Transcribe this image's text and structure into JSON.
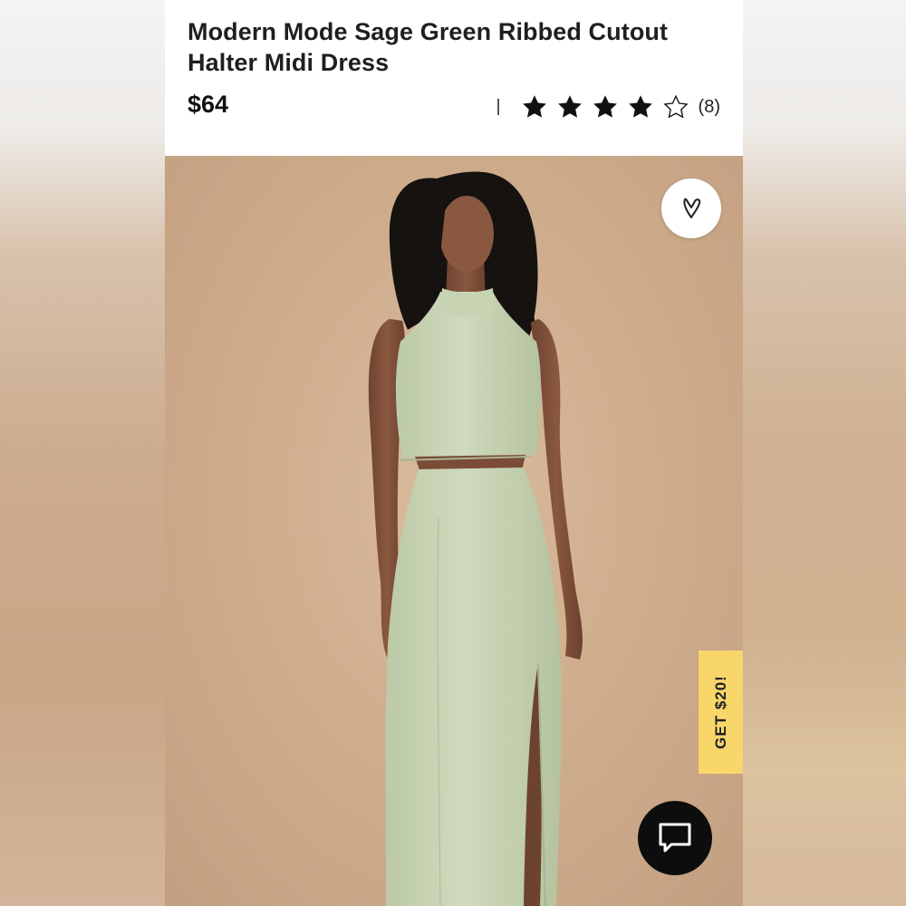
{
  "product": {
    "title": "Modern Mode Sage Green Ribbed Cutout Halter Midi Dress",
    "price": "$64",
    "rating": {
      "stars_filled": 4,
      "stars_total": 5,
      "review_count": "(8)"
    }
  },
  "image": {
    "alt": "Model wearing sage green halter midi dress with cutouts"
  },
  "actions": {
    "favorite_icon": "heart-icon",
    "promo_label": "GET $20!",
    "chat_icon": "chat-bubble-icon"
  },
  "colors": {
    "promo_tab": "#f8d66a",
    "dress": "#c7d3b3",
    "background": "#d2b396",
    "chat_button": "#0d0d0d"
  }
}
